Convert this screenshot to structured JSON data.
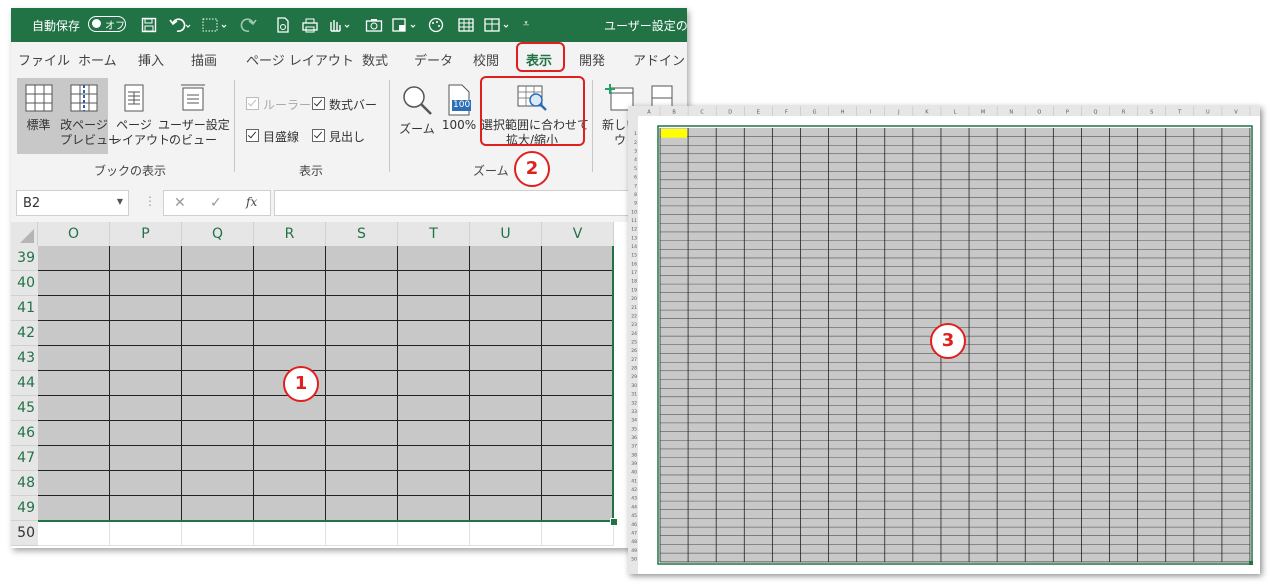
{
  "title_bar": {
    "autosave_label": "自動保存",
    "autosave_state": "オフ",
    "document_title": "ユーザー設定のビ"
  },
  "tabs": [
    "ファイル",
    "ホーム",
    "挿入",
    "描画",
    "ページ レイアウト",
    "数式",
    "データ",
    "校閲",
    "表示",
    "開発",
    "アドイン"
  ],
  "active_tab": "表示",
  "ribbon": {
    "book_views": {
      "group_label": "ブックの表示",
      "normal": "標準",
      "page_break_1": "改ページ",
      "page_break_2": "プレビュー",
      "page_layout_1": "ページ",
      "page_layout_2": "レイアウト",
      "custom_1": "ユーザー設定",
      "custom_2": "のビュー"
    },
    "show": {
      "group_label": "表示",
      "ruler": "ルーラー",
      "formula_bar": "数式バー",
      "gridlines": "目盛線",
      "headings": "見出し"
    },
    "zoom": {
      "group_label": "ズーム",
      "zoom": "ズーム",
      "zoom_100": "100%",
      "zoom_100_icon_text": "100",
      "zoom_selection_1": "選択範囲に合わせて",
      "zoom_selection_2": "拡大/縮小"
    },
    "window": {
      "new_window_1": "新しい",
      "new_window_2": "ウ"
    }
  },
  "formula_bar": {
    "name_box": "B2",
    "fx": "fx",
    "cancel": "✕",
    "enter": "✓"
  },
  "sheet": {
    "columns": [
      "O",
      "P",
      "Q",
      "R",
      "S",
      "T",
      "U",
      "V"
    ],
    "rows": [
      "39",
      "40",
      "41",
      "42",
      "43",
      "44",
      "45",
      "46",
      "47",
      "48",
      "49",
      "50"
    ]
  },
  "annotations": [
    "1",
    "2",
    "3"
  ],
  "preview": {
    "columns": [
      "A",
      "B",
      "C",
      "D",
      "E",
      "F",
      "G",
      "H",
      "I",
      "J",
      "K",
      "L",
      "M",
      "N",
      "O",
      "P",
      "Q",
      "R",
      "S",
      "T",
      "U",
      "V"
    ],
    "row_count": 50,
    "highlight_color": "#ffff00"
  },
  "colors": {
    "accent": "#217346",
    "annotation": "#e0201f",
    "selection_fill": "#c8c8c8"
  }
}
